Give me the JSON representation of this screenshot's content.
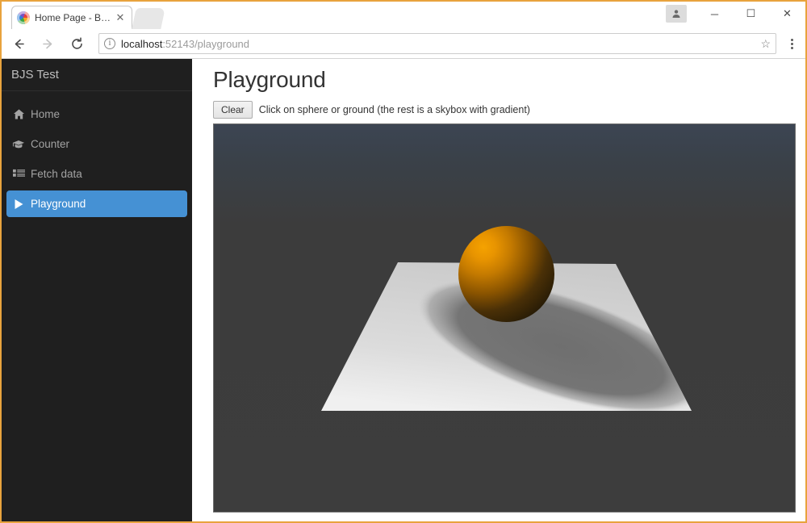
{
  "browser": {
    "tab": {
      "title": "Home Page - BJS Test",
      "favicon_icon": "babylon-logo-icon",
      "close_icon": "close-icon"
    },
    "new_tab_icon": "new-tab-icon",
    "window_controls": {
      "profile_icon": "person-icon",
      "minimize_label": "─",
      "maximize_label": "☐",
      "close_label": "✕"
    },
    "toolbar": {
      "back_icon": "back-arrow-icon",
      "forward_icon": "forward-arrow-icon",
      "reload_icon": "reload-icon",
      "info_icon": "info-icon",
      "info_glyph": "i",
      "url_host": "localhost",
      "url_rest": ":52143/playground",
      "star_icon": "star-icon",
      "star_glyph": "☆",
      "menu_icon": "three-dot-menu-icon"
    }
  },
  "sidebar": {
    "brand": "BJS Test",
    "items": [
      {
        "label": "Home",
        "icon": "home-icon",
        "active": false
      },
      {
        "label": "Counter",
        "icon": "graduation-cap-icon",
        "active": false
      },
      {
        "label": "Fetch data",
        "icon": "list-icon",
        "active": false
      },
      {
        "label": "Playground",
        "icon": "play-icon",
        "active": true
      }
    ],
    "active_color": "#4591d4",
    "background_color": "#1f1f1f"
  },
  "main": {
    "title": "Playground",
    "clear_button": "Clear",
    "hint": "Click on sphere or ground (the rest is a skybox with gradient)",
    "scene": {
      "canvas_name": "babylon-canvas",
      "sky_top_color": "#3c4553",
      "sky_bottom_color": "#3d3d3d",
      "ground_color": "#d2d2d2",
      "sphere_color": "#e89400",
      "shadow_color": "#767676",
      "sphere_name": "sphere",
      "ground_name": "ground",
      "shadow_name": "sphere-shadow"
    }
  }
}
